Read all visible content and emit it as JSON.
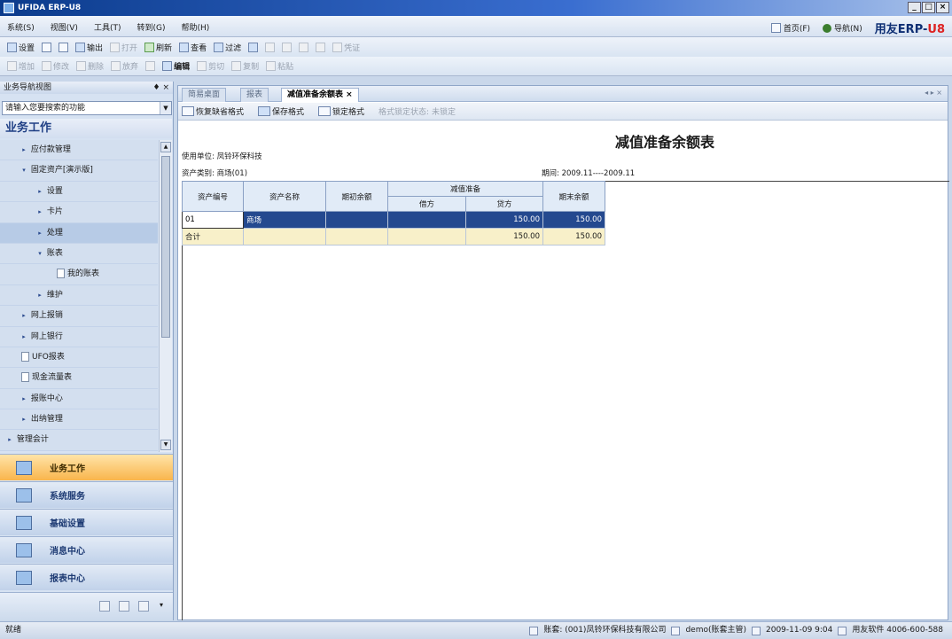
{
  "window": {
    "title": "UFIDA ERP-U8",
    "min": "_",
    "max": "□",
    "close": "×"
  },
  "menu": [
    "系统(S)",
    "视图(V)",
    "工具(T)",
    "转到(G)",
    "帮助(H)"
  ],
  "menu_right": {
    "home": "首页(F)",
    "nav": "导航(N)",
    "brand_main": "用友ERP-",
    "brand_accent": "U8"
  },
  "toolbar1": [
    "设置",
    "输出",
    "打开",
    "刷新",
    "查看",
    "过滤",
    "凭证"
  ],
  "toolbar2": [
    "增加",
    "修改",
    "删除",
    "放弃",
    "编辑",
    "剪切",
    "复制",
    "粘贴"
  ],
  "nav": {
    "header": "业务导航视图",
    "pin": "♦ ×",
    "search_placeholder": "请输入您要搜索的功能",
    "section_title": "业务工作",
    "items": [
      {
        "label": "应付款管理",
        "arrow": "▸"
      },
      {
        "label": "固定资产[演示版]",
        "arrow": "▾"
      },
      {
        "label": "设置",
        "arrow": "▸"
      },
      {
        "label": "卡片",
        "arrow": "▸"
      },
      {
        "label": "处理",
        "arrow": "▸"
      },
      {
        "label": "账表",
        "arrow": "▾"
      },
      {
        "label": "我的账表",
        "arrow": ""
      },
      {
        "label": "维护",
        "arrow": "▸"
      },
      {
        "label": "网上报销",
        "arrow": "▸"
      },
      {
        "label": "网上银行",
        "arrow": "▸"
      },
      {
        "label": "UFO报表",
        "arrow": ""
      },
      {
        "label": "现金流量表",
        "arrow": ""
      },
      {
        "label": "报账中心",
        "arrow": "▸"
      },
      {
        "label": "出纳管理",
        "arrow": "▸"
      },
      {
        "label": "管理会计",
        "arrow": "▸"
      }
    ],
    "big_buttons": [
      "业务工作",
      "系统服务",
      "基础设置",
      "消息中心",
      "报表中心"
    ]
  },
  "tabs": [
    "简易桌面",
    "报表",
    "减值准备余额表"
  ],
  "tab_close": "×",
  "tab_nav": "◂ ▸ ×",
  "report_toolbar": {
    "restore": "恢复缺省格式",
    "save": "保存格式",
    "lock": "锁定格式",
    "lock_state": "格式锁定状态: 未锁定"
  },
  "report": {
    "title": "减值准备余额表",
    "unit": "使用单位: 凤铃环保科技",
    "category": "资产类别: 商场(01)",
    "period": "期间: 2009.11----2009.11",
    "headers": {
      "code": "资产编号",
      "name": "资产名称",
      "opening": "期初余额",
      "group": "减值准备",
      "debit": "借方",
      "credit": "贷方",
      "closing": "期末余额"
    },
    "rows": [
      {
        "code": "01",
        "name": "商场",
        "opening": "",
        "debit": "",
        "credit": "150.00",
        "closing": "150.00"
      },
      {
        "code": "合计",
        "name": "",
        "opening": "",
        "debit": "",
        "credit": "150.00",
        "closing": "150.00"
      }
    ]
  },
  "status": {
    "left": "就绪",
    "account": "账套: (001)凤铃环保科技有限公司",
    "user": "demo(账套主管)",
    "date": "2009-11-09 9:04",
    "phone": "用友软件 4006-600-588"
  }
}
